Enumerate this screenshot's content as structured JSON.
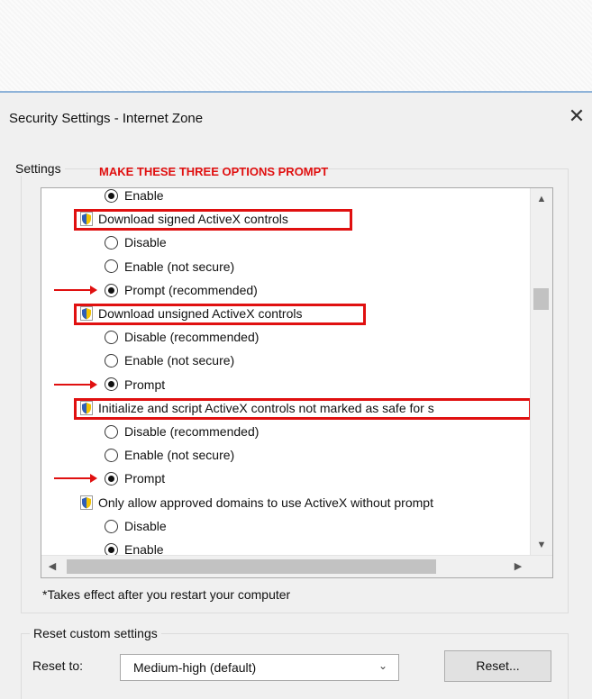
{
  "dialog": {
    "title": "Security Settings - Internet Zone",
    "close_glyph": "✕"
  },
  "settings": {
    "group_label": "Settings",
    "instruction": "MAKE THESE THREE OPTIONS PROMPT",
    "rows": [
      {
        "kind": "radio",
        "checked": true,
        "label": "Enable"
      },
      {
        "kind": "category",
        "icon": "shield-icon",
        "label": "Download signed ActiveX controls",
        "highlighted": true
      },
      {
        "kind": "radio",
        "checked": false,
        "label": "Disable"
      },
      {
        "kind": "radio",
        "checked": false,
        "label": "Enable (not secure)"
      },
      {
        "kind": "radio",
        "checked": true,
        "label": "Prompt (recommended)",
        "arrow": true
      },
      {
        "kind": "category",
        "icon": "shield-icon",
        "label": "Download unsigned ActiveX controls",
        "highlighted": true
      },
      {
        "kind": "radio",
        "checked": false,
        "label": "Disable (recommended)"
      },
      {
        "kind": "radio",
        "checked": false,
        "label": "Enable (not secure)"
      },
      {
        "kind": "radio",
        "checked": true,
        "label": "Prompt",
        "arrow": true
      },
      {
        "kind": "category",
        "icon": "shield-icon",
        "label": "Initialize and script ActiveX controls not marked as safe for s",
        "highlighted": true
      },
      {
        "kind": "radio",
        "checked": false,
        "label": "Disable (recommended)"
      },
      {
        "kind": "radio",
        "checked": false,
        "label": "Enable (not secure)"
      },
      {
        "kind": "radio",
        "checked": true,
        "label": "Prompt",
        "arrow": true
      },
      {
        "kind": "category",
        "icon": "shield-icon",
        "label": "Only allow approved domains to use ActiveX without prompt"
      },
      {
        "kind": "radio",
        "checked": false,
        "label": "Disable"
      },
      {
        "kind": "radio",
        "checked": true,
        "label": "Enable"
      }
    ],
    "scroll_up": "▲",
    "scroll_down": "▼",
    "scroll_left": "◀",
    "scroll_right": "▶",
    "footnote": "*Takes effect after you restart your computer"
  },
  "reset": {
    "group_label": "Reset custom settings",
    "reset_to_label": "Reset to:",
    "selected_value": "Medium-high (default)",
    "chevron": "⌄",
    "button_label": "Reset..."
  },
  "colors": {
    "highlight": "#e01010",
    "shield_yellow": "#f2c300",
    "shield_blue": "#2f5fb8"
  }
}
